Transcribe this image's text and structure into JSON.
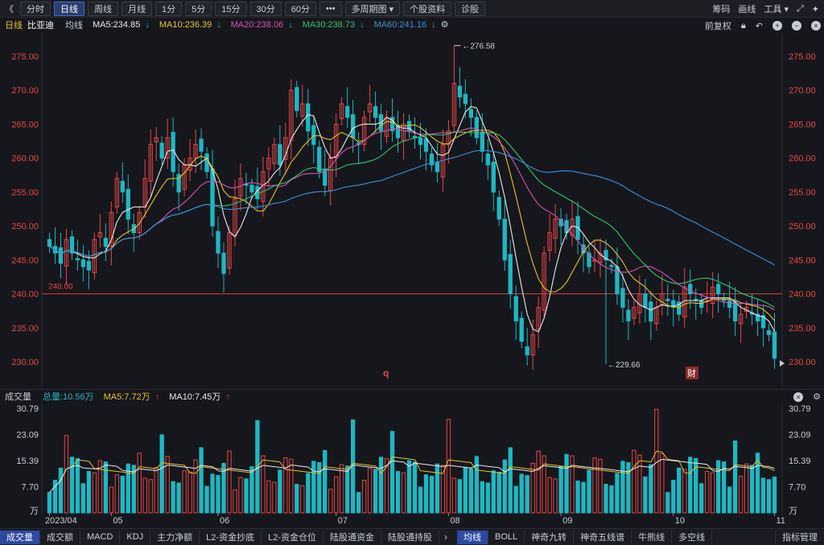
{
  "toolbar": {
    "back_label": "《",
    "buttons": [
      "分时",
      "日线",
      "周线",
      "月线",
      "1分",
      "5分",
      "15分",
      "30分",
      "60分",
      "•••",
      "多周期图",
      "个股资料",
      "诊股"
    ],
    "active": "日线",
    "right": [
      "筹码",
      "画线",
      "工具"
    ]
  },
  "ma_bar": {
    "period": "日线",
    "name": "比亚迪",
    "avg": "均线",
    "ma5": "MA5:234.85",
    "ma10": "MA10:236.39",
    "ma20": "MA20:238.06",
    "ma30": "MA30:238.73",
    "ma60": "MA60:241.16",
    "right_label": "前复权",
    "colors": {
      "ma5": "#e8e8e8",
      "ma10": "#e6c12b",
      "ma20": "#d94fb8",
      "ma30": "#35c46a",
      "ma60": "#3a8fe0"
    }
  },
  "price_axis": [
    "275.00",
    "270.00",
    "265.00",
    "260.00",
    "255.00",
    "250.00",
    "245.00",
    "240.00",
    "235.00",
    "230.00"
  ],
  "price_annotations": {
    "high": "276.58",
    "low": "229.66",
    "line": "240.00"
  },
  "event_badges": {
    "q_mark": "q",
    "cai_mark": "财"
  },
  "volume": {
    "title": "成交量",
    "total": "总量:10.56万",
    "ma5": "MA5:7.72万",
    "ma10": "MA10:7.45万",
    "axis": [
      "30.79",
      "23.09",
      "15.39",
      "7.70",
      "万"
    ]
  },
  "date_axis": [
    "2023/04",
    "05",
    "06",
    "07",
    "08",
    "09",
    "10",
    "11"
  ],
  "bottom_tabs": {
    "left": [
      "成交量",
      "成交额",
      "MACD",
      "KDJ",
      "主力净额",
      "L2-资金抄底",
      "L2-资金仓位",
      "陆股通资金",
      "陆股通持股"
    ],
    "right": [
      "均线",
      "BOLL",
      "神奇九转",
      "神奇五线谱",
      "牛熊线",
      "多空线"
    ],
    "left_active": "成交量",
    "right_active": "均线",
    "end_label": "指标管理"
  },
  "colors": {
    "up": "#e84545",
    "down": "#1fb7c3",
    "bg": "#16171c"
  },
  "chart_data": {
    "type": "candlestick",
    "y_range": [
      228,
      278
    ],
    "closes": [
      247.0,
      246.0,
      244.5,
      248.0,
      246.0,
      245.0,
      244.0,
      243.5,
      248.0,
      249.0,
      247.0,
      252.0,
      257.0,
      255.0,
      251.0,
      249.0,
      252.0,
      257.0,
      262.0,
      263.0,
      260.0,
      263.0,
      258.0,
      255.0,
      259.0,
      260.0,
      262.0,
      261.0,
      258.0,
      250.0,
      246.0,
      243.0,
      249.0,
      254.0,
      257.0,
      256.0,
      255.0,
      254.0,
      258.0,
      260.0,
      262.0,
      259.0,
      263.0,
      270.0,
      267.0,
      268.0,
      264.0,
      262.0,
      258.0,
      256.0,
      260.0,
      265.0,
      268.0,
      266.0,
      263.0,
      262.0,
      266.0,
      268.0,
      266.0,
      264.0,
      266.0,
      264.0,
      263.0,
      265.0,
      264.0,
      263.0,
      262.0,
      261.0,
      259.0,
      258.0,
      262.0,
      264.0,
      271.0,
      269.0,
      268.0,
      266.0,
      263.0,
      261.0,
      259.0,
      255.0,
      251.0,
      245.0,
      240.0,
      236.0,
      233.0,
      231.0,
      234.0,
      238.0,
      246.0,
      249.0,
      251.0,
      250.0,
      249.0,
      251.0,
      248.0,
      246.0,
      244.0,
      245.0,
      246.0,
      245.0,
      244.0,
      240.0,
      238.0,
      236.0,
      238.0,
      240.0,
      238.0,
      236.0,
      238.0,
      240.0,
      239.0,
      238.0,
      237.0,
      241.0,
      240.0,
      239.0,
      238.0,
      239.0,
      241.0,
      240.0,
      239.0,
      238.0,
      236.0,
      237.0,
      238.0,
      237.0,
      236.0,
      235.0,
      234.0,
      230.5
    ],
    "last": {
      "close": 230.5,
      "high_max": 276.58,
      "low_min": 229.66
    }
  }
}
